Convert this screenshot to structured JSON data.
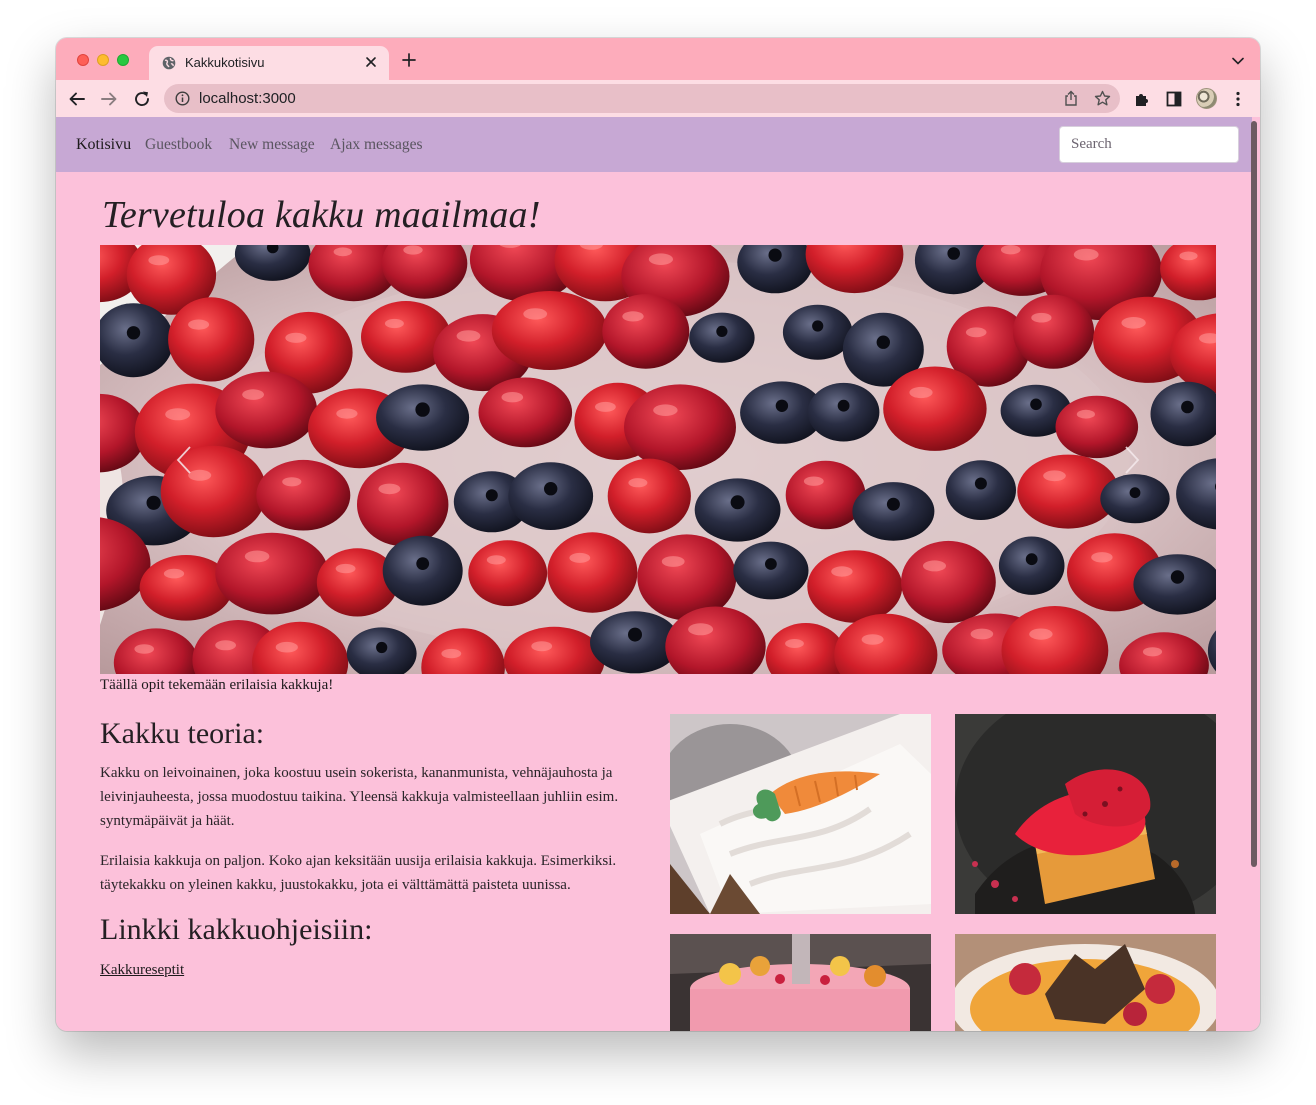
{
  "browser": {
    "tab_title": "Kakkukotisivu",
    "url": "localhost:3000"
  },
  "navbar": {
    "brand": "Kotisivu",
    "links": [
      {
        "label": "Guestbook"
      },
      {
        "label": "New message"
      },
      {
        "label": "Ajax messages"
      }
    ],
    "search_placeholder": "Search"
  },
  "page": {
    "title": "Tervetuloa kakku maailmaa!",
    "carousel_caption": "Täällä opit tekemään erilaisia kakkuja!",
    "theory": {
      "heading": "Kakku teoria:",
      "paragraphs": [
        "Kakku on leivoinainen, joka koostuu usein sokerista, kananmunista, vehnäjauhosta ja leivinjauheesta, jossa muodostuu taikina. Yleensä kakkuja valmisteellaan juhliin esim. syntymäpäivät ja häät.",
        "Erilaisia kakkuja on paljon. Koko ajan keksitään uusija erilaisia kakkuja. Esimerkiksi. täytekakku on yleinen kakku, juustokakku, jota ei välttämättä paisteta uunissa."
      ]
    },
    "links_section": {
      "heading": "Linkki kakkuohjeisiin:",
      "link_label": "Kakkureseptit"
    }
  },
  "colors": {
    "page_background": "#fcc1da",
    "navbar_background": "#c7a8d4",
    "tab_strip": "#fdacbb",
    "toolbar": "#fddde4"
  },
  "icons": {
    "tab_favicon": "globe-icon",
    "carousel_prev": "chevron-left-icon",
    "carousel_next": "chevron-right-icon"
  }
}
